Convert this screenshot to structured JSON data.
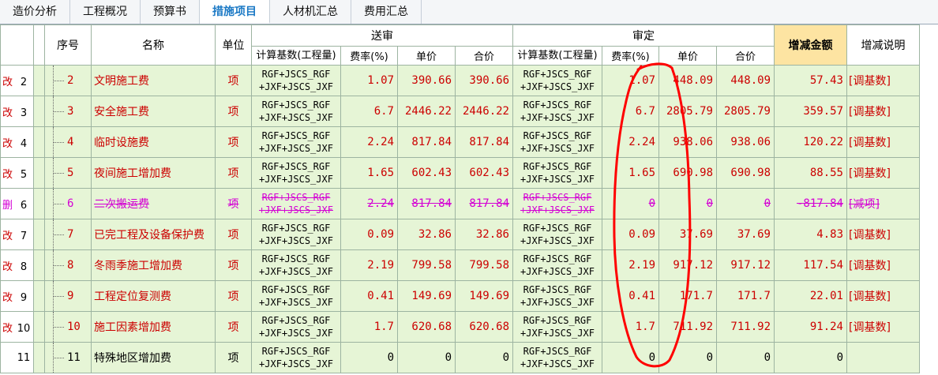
{
  "tabs": [
    {
      "label": "造价分析",
      "active": false
    },
    {
      "label": "工程概况",
      "active": false
    },
    {
      "label": "预算书",
      "active": false
    },
    {
      "label": "措施项目",
      "active": true
    },
    {
      "label": "人材机汇总",
      "active": false
    },
    {
      "label": "费用汇总",
      "active": false
    }
  ],
  "header": {
    "seq": "序号",
    "name": "名称",
    "unit": "单位",
    "submitted": "送审",
    "approved": "审定",
    "basis": "计算基数(工程量)",
    "rate": "费率(%)",
    "unit_price": "单价",
    "total": "合价",
    "delta": "增减金额",
    "note": "增减说明"
  },
  "rows": [
    {
      "status": "changed",
      "flag": "改",
      "row": "2",
      "seq": "2",
      "name": "文明施工费",
      "unit": "项",
      "s_basis": "RGF+JSCS_RGF\n+JXF+JSCS_JXF",
      "s_rate": "1.07",
      "s_price": "390.66",
      "s_total": "390.66",
      "a_basis": "RGF+JSCS_RGF\n+JXF+JSCS_JXF",
      "a_rate": "1.07",
      "a_price": "448.09",
      "a_total": "448.09",
      "delta": "57.43",
      "note": "[调基数]"
    },
    {
      "status": "changed",
      "flag": "改",
      "row": "3",
      "seq": "3",
      "name": "安全施工费",
      "unit": "项",
      "s_basis": "RGF+JSCS_RGF\n+JXF+JSCS_JXF",
      "s_rate": "6.7",
      "s_price": "2446.22",
      "s_total": "2446.22",
      "a_basis": "RGF+JSCS_RGF\n+JXF+JSCS_JXF",
      "a_rate": "6.7",
      "a_price": "2805.79",
      "a_total": "2805.79",
      "delta": "359.57",
      "note": "[调基数]"
    },
    {
      "status": "changed",
      "flag": "改",
      "row": "4",
      "seq": "4",
      "name": "临时设施费",
      "unit": "项",
      "s_basis": "RGF+JSCS_RGF\n+JXF+JSCS_JXF",
      "s_rate": "2.24",
      "s_price": "817.84",
      "s_total": "817.84",
      "a_basis": "RGF+JSCS_RGF\n+JXF+JSCS_JXF",
      "a_rate": "2.24",
      "a_price": "938.06",
      "a_total": "938.06",
      "delta": "120.22",
      "note": "[调基数]"
    },
    {
      "status": "changed",
      "flag": "改",
      "row": "5",
      "seq": "5",
      "name": "夜间施工增加费",
      "unit": "项",
      "s_basis": "RGF+JSCS_RGF\n+JXF+JSCS_JXF",
      "s_rate": "1.65",
      "s_price": "602.43",
      "s_total": "602.43",
      "a_basis": "RGF+JSCS_RGF\n+JXF+JSCS_JXF",
      "a_rate": "1.65",
      "a_price": "690.98",
      "a_total": "690.98",
      "delta": "88.55",
      "note": "[调基数]"
    },
    {
      "status": "deleted",
      "flag": "删",
      "row": "6",
      "seq": "6",
      "name": "二次搬运费",
      "unit": "项",
      "s_basis": "RGF+JSCS_RGF\n+JXF+JSCS_JXF",
      "s_rate": "2.24",
      "s_price": "817.84",
      "s_total": "817.84",
      "a_basis": "RGF+JSCS_RGF\n+JXF+JSCS_JXF",
      "a_rate": "0",
      "a_price": "0",
      "a_total": "0",
      "delta": "-817.84",
      "note": "[减项]"
    },
    {
      "status": "changed",
      "flag": "改",
      "row": "7",
      "seq": "7",
      "name": "已完工程及设备保护费",
      "unit": "项",
      "s_basis": "RGF+JSCS_RGF\n+JXF+JSCS_JXF",
      "s_rate": "0.09",
      "s_price": "32.86",
      "s_total": "32.86",
      "a_basis": "RGF+JSCS_RGF\n+JXF+JSCS_JXF",
      "a_rate": "0.09",
      "a_price": "37.69",
      "a_total": "37.69",
      "delta": "4.83",
      "note": "[调基数]"
    },
    {
      "status": "changed",
      "flag": "改",
      "row": "8",
      "seq": "8",
      "name": "冬雨季施工增加费",
      "unit": "项",
      "s_basis": "RGF+JSCS_RGF\n+JXF+JSCS_JXF",
      "s_rate": "2.19",
      "s_price": "799.58",
      "s_total": "799.58",
      "a_basis": "RGF+JSCS_RGF\n+JXF+JSCS_JXF",
      "a_rate": "2.19",
      "a_price": "917.12",
      "a_total": "917.12",
      "delta": "117.54",
      "note": "[调基数]"
    },
    {
      "status": "changed",
      "flag": "改",
      "row": "9",
      "seq": "9",
      "name": "工程定位复测费",
      "unit": "项",
      "s_basis": "RGF+JSCS_RGF\n+JXF+JSCS_JXF",
      "s_rate": "0.41",
      "s_price": "149.69",
      "s_total": "149.69",
      "a_basis": "RGF+JSCS_RGF\n+JXF+JSCS_JXF",
      "a_rate": "0.41",
      "a_price": "171.7",
      "a_total": "171.7",
      "delta": "22.01",
      "note": "[调基数]"
    },
    {
      "status": "changed",
      "flag": "改",
      "row": "10",
      "seq": "10",
      "name": "施工因素增加费",
      "unit": "项",
      "s_basis": "RGF+JSCS_RGF\n+JXF+JSCS_JXF",
      "s_rate": "1.7",
      "s_price": "620.68",
      "s_total": "620.68",
      "a_basis": "RGF+JSCS_RGF\n+JXF+JSCS_JXF",
      "a_rate": "1.7",
      "a_price": "711.92",
      "a_total": "711.92",
      "delta": "91.24",
      "note": "[调基数]"
    },
    {
      "status": "normal",
      "flag": "",
      "row": "11",
      "seq": "11",
      "name": "特殊地区增加费",
      "unit": "项",
      "s_basis": "RGF+JSCS_RGF\n+JXF+JSCS_JXF",
      "s_rate": "0",
      "s_price": "0",
      "s_total": "0",
      "a_basis": "RGF+JSCS_RGF\n+JXF+JSCS_JXF",
      "a_rate": "0",
      "a_price": "0",
      "a_total": "0",
      "delta": "0",
      "note": ""
    }
  ],
  "colors": {
    "changed_text": "#cc0000",
    "deleted_text": "#d400d4",
    "row_bg": "#e6f5d6",
    "delta_header_bg": "#fde4a2",
    "active_tab": "#1b79c5",
    "annotation": "#ff0000"
  },
  "annotation": {
    "shape": "hand-drawn-ellipse",
    "around": "审定 费率(%) column"
  }
}
